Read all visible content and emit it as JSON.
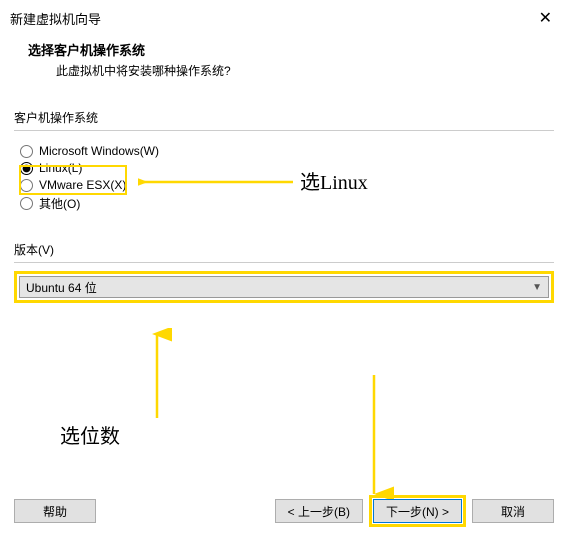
{
  "window": {
    "title": "新建虚拟机向导"
  },
  "header": {
    "title": "选择客户机操作系统",
    "subtitle": "此虚拟机中将安装哪种操作系统?"
  },
  "os_group": {
    "label": "客户机操作系统",
    "options": [
      {
        "label": "Microsoft Windows(W)"
      },
      {
        "label": "Linux(L)"
      },
      {
        "label": "VMware ESX(X)"
      },
      {
        "label": "其他(O)"
      }
    ]
  },
  "version": {
    "label": "版本(V)",
    "selected": "Ubuntu 64 位"
  },
  "annotations": {
    "select_linux": "选Linux",
    "select_bits": "选位数"
  },
  "footer": {
    "help": "帮助",
    "back": "< 上一步(B)",
    "next": "下一步(N) >",
    "cancel": "取消"
  },
  "colors": {
    "highlight": "#ffd800"
  }
}
